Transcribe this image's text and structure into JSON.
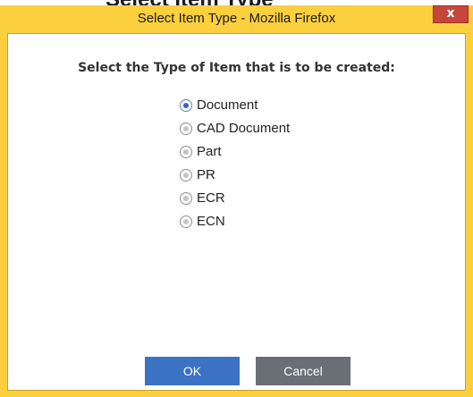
{
  "window": {
    "title": "Select Item Type - Mozilla Firefox",
    "close_icon": "close-icon"
  },
  "background_page": {
    "partial_heading": "Select Item Type"
  },
  "dialog": {
    "prompt": "Select the Type of Item that is to be created:",
    "selected": "Document",
    "options": [
      {
        "label": "Document",
        "selected": true
      },
      {
        "label": "CAD Document",
        "selected": false
      },
      {
        "label": "Part",
        "selected": false
      },
      {
        "label": "PR",
        "selected": false
      },
      {
        "label": "ECR",
        "selected": false
      },
      {
        "label": "ECN",
        "selected": false
      }
    ],
    "ok_label": "OK",
    "cancel_label": "Cancel"
  },
  "colors": {
    "window_frame": "#fbcf3e",
    "close_button": "#c7463b",
    "ok_button": "#3c72c3",
    "cancel_button": "#6a6f76",
    "radio_selected": "#3a64b8"
  }
}
